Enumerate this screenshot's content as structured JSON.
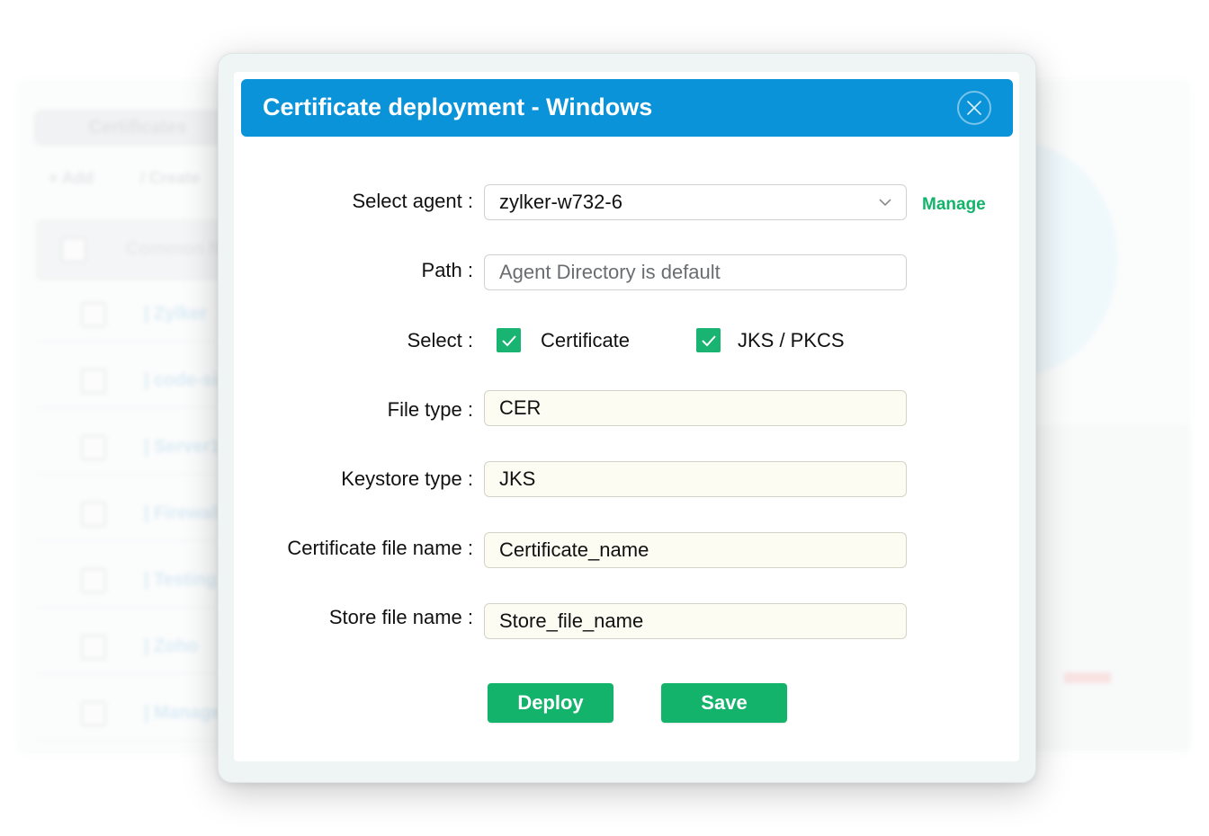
{
  "background": {
    "tab_label": "Certificates",
    "toolbar": {
      "add": "+ Add",
      "create": "/ Create"
    },
    "header_label": "Common N",
    "rows": [
      "| Zylker",
      "| code-sign",
      "| Server1",
      "| Firewall",
      "| Testing",
      "| Zoho",
      "| ManageEn"
    ]
  },
  "modal": {
    "title": "Certificate deployment - Windows",
    "close_icon": "close-icon",
    "fields": {
      "agent": {
        "label": "Select agent :",
        "value": "zylker-w732-6",
        "manage": "Manage"
      },
      "path": {
        "label": "Path :",
        "placeholder": "Agent Directory is default"
      },
      "select": {
        "label": "Select :",
        "options": [
          {
            "label": "Certificate",
            "checked": true
          },
          {
            "label": "JKS / PKCS",
            "checked": true
          }
        ]
      },
      "file_type": {
        "label": "File type :",
        "value": "CER"
      },
      "keystore_type": {
        "label": "Keystore type :",
        "value": "JKS"
      },
      "cert_file_name": {
        "label": "Certificate file name :",
        "value": "Certificate_name"
      },
      "store_file_name": {
        "label": "Store file name :",
        "value": "Store_file_name"
      }
    },
    "buttons": {
      "deploy": "Deploy",
      "save": "Save"
    }
  },
  "colors": {
    "header": "#0a93d8",
    "accent_green": "#14b36b",
    "filled_field_bg": "#fdfcf2"
  }
}
